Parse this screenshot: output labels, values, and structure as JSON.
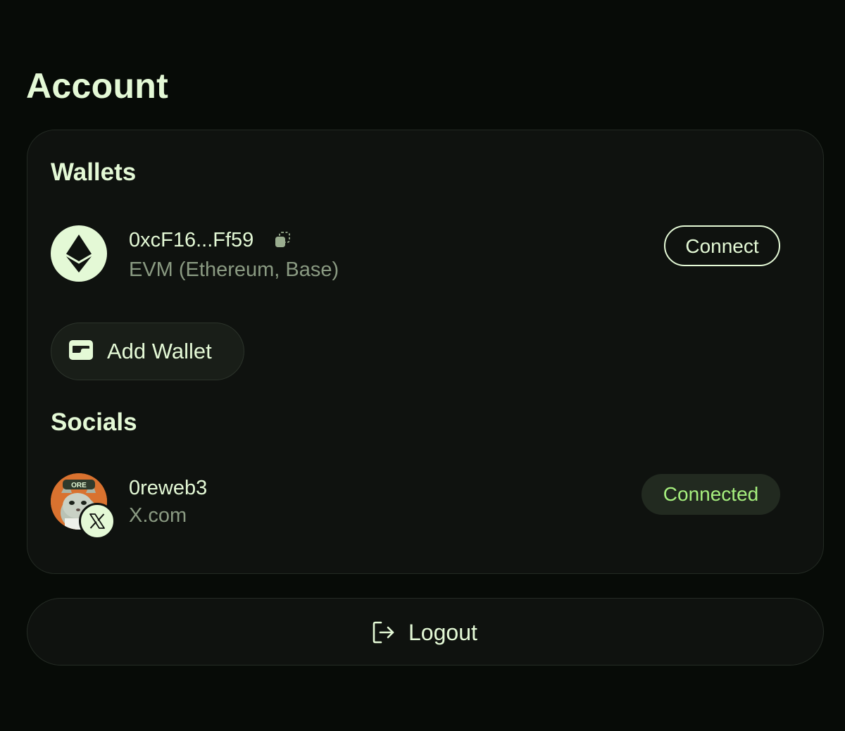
{
  "page": {
    "title": "Account"
  },
  "wallets": {
    "title": "Wallets",
    "items": [
      {
        "address": "0xcF16...Ff59",
        "network": "EVM (Ethereum, Base)",
        "icon": "ethereum-icon",
        "action_label": "Connect"
      }
    ],
    "add_wallet_label": "Add Wallet"
  },
  "socials": {
    "title": "Socials",
    "items": [
      {
        "username": "0reweb3",
        "platform": "X.com",
        "avatar_text": "ORE",
        "status_label": "Connected"
      }
    ]
  },
  "logout": {
    "label": "Logout"
  },
  "colors": {
    "background": "#070b07",
    "card": "#0f120f",
    "text_primary": "#e4f9d6",
    "text_secondary": "#8a9a82",
    "accent_connected": "#a6ef7e"
  }
}
